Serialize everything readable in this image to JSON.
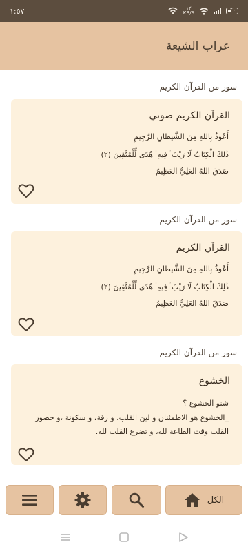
{
  "status_bar": {
    "time": "١:٥٧",
    "battery": "٢١",
    "net_speed_value": "١٢",
    "net_speed_unit": "KB/S"
  },
  "app_bar": {
    "title": "عراب الشيعة"
  },
  "sections": [
    {
      "label": "سور من القرآن الكريم",
      "title": "القرآن الكريم صوتي",
      "lines": [
        "أَعُوذُ بِاللهِ مِنَ الشَّيطانِ الرَّجِيمِ",
        "ذَٰلِكَ الْكِتَابُ لَا رَيْبَ ۛ فِيهِ ۛ هُدًى لِّلْمُتَّقِينَ (٢)",
        "صَدَقَ اللهُ العَلِيُّ العَظِيمُ"
      ]
    },
    {
      "label": "سور من القرآن الكريم",
      "title": "القرآن الكريم",
      "lines": [
        "أَعُوذُ بِاللهِ مِنَ الشَّيطانِ الرَّجِيمِ",
        "ذَٰلِكَ الْكِتَابُ لَا رَيْبَ ۛ فِيهِ ۛ هُدًى لِّلْمُتَّقِينَ (٢)",
        "صَدَقَ اللهُ العَلِيُّ العَظِيمُ"
      ]
    },
    {
      "label": "سور من القرآن الكريم",
      "title": "الخشوع",
      "lines": [
        "شنو الخشوع ؟",
        "_الخشوع هو الاطمئنان و لين القلب، و رقة، و سكونة ،و حضور القلب وقت الطاعة لله، و تضرع القلب لله."
      ]
    }
  ],
  "bottom_nav": {
    "all_label": "الكل"
  },
  "icons": {
    "heart": "heart-outline-icon",
    "home": "home-icon",
    "search": "search-icon",
    "settings": "gear-icon",
    "menu": "menu-icon"
  },
  "colors": {
    "app_bar": "#e6c3a1",
    "card": "#fdf1dd",
    "status_bar": "#5c4d3e",
    "icon": "#4a3d30"
  }
}
